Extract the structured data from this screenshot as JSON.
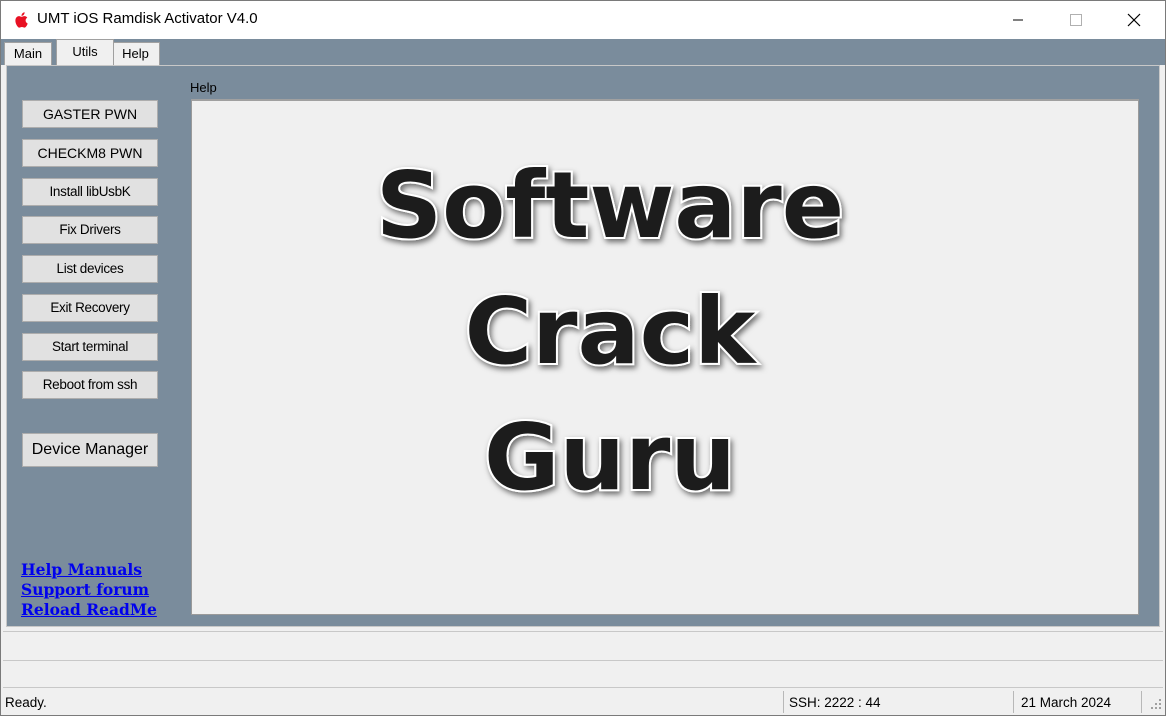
{
  "window": {
    "title": "UMT iOS Ramdisk Activator V4.0",
    "app_icon": "apple-logo-icon",
    "controls": [
      "minimize-icon",
      "maximize-icon",
      "close-icon"
    ]
  },
  "tabs": [
    {
      "label": "Main",
      "selected": false
    },
    {
      "label": "Utils",
      "selected": true
    },
    {
      "label": "Help",
      "selected": false
    }
  ],
  "sidebar": {
    "buttons": [
      {
        "label": "GASTER PWN"
      },
      {
        "label": "CHECKM8 PWN"
      },
      {
        "label": "Install libUsbK"
      },
      {
        "label": "Fix Drivers"
      },
      {
        "label": "List devices"
      },
      {
        "label": "Exit Recovery"
      },
      {
        "label": "Start terminal"
      },
      {
        "label": "Reboot from ssh"
      }
    ],
    "device_manager_label": "Device Manager",
    "links": [
      {
        "label": "Help Manuals"
      },
      {
        "label": "Support forum"
      },
      {
        "label": "Reload ReadMe"
      }
    ]
  },
  "help_panel": {
    "label": "Help",
    "watermark_lines": [
      "Software",
      "Crack",
      "Guru"
    ]
  },
  "status": {
    "left": "Ready.",
    "ssh": "SSH: 2222 : 44",
    "date": "21 March 2024"
  },
  "colors": {
    "panel_bg": "#7a8c9c",
    "link": "#0000ee",
    "control_bg": "#f0f0f0"
  }
}
